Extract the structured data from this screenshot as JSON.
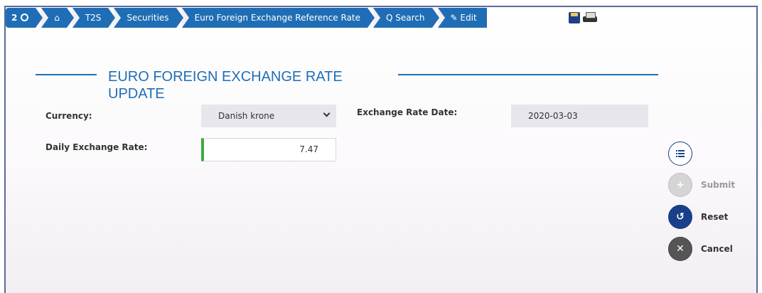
{
  "breadcrumb": {
    "view_count": "2",
    "home_icon": "home-icon",
    "items": [
      "T2S",
      "Securities",
      "Euro Foreign Exchange Reference Rate",
      "Q Search",
      "Edit"
    ]
  },
  "toolbar": {
    "save_icon": "save-icon",
    "print_icon": "print-icon"
  },
  "page": {
    "title": "EURO FOREIGN EXCHANGE RATE UPDATE"
  },
  "form": {
    "currency_label": "Currency:",
    "currency_value": "Danish krone",
    "exchange_rate_date_label": "Exchange Rate Date:",
    "exchange_rate_date_value": "2020-03-03",
    "daily_exchange_rate_label": "Daily Exchange Rate:",
    "daily_exchange_rate_value": "7.47"
  },
  "actions": {
    "menu_icon": "list-icon",
    "submit_label": "Submit",
    "reset_label": "Reset",
    "cancel_label": "Cancel"
  },
  "colors": {
    "brand_blue": "#1f6eb5",
    "dark_blue": "#1a3f8a",
    "valid_green": "#3caa46"
  }
}
